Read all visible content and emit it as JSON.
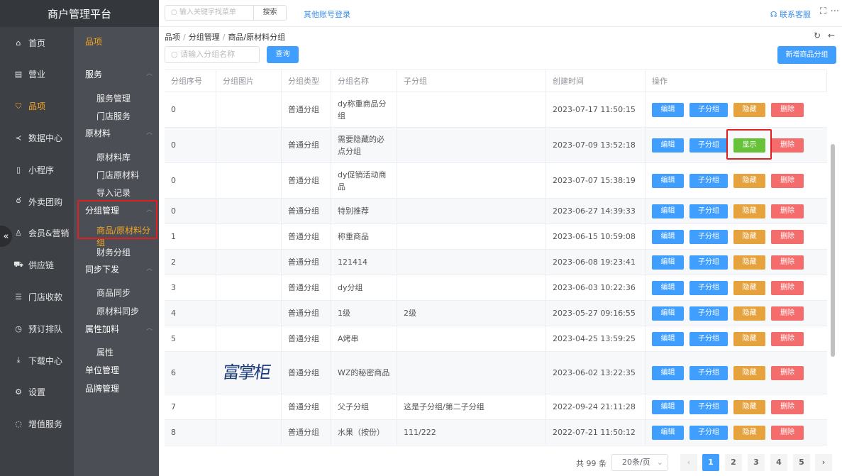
{
  "app": {
    "title": "商户管理平台"
  },
  "topbar": {
    "search_placeholder": "输入关键字找菜单",
    "search_button": "搜索",
    "other_login": "其他账号登录",
    "service": "联系客服"
  },
  "nav_primary": [
    {
      "label": "首页",
      "icon": "home-icon"
    },
    {
      "label": "营业",
      "icon": "calendar-icon"
    },
    {
      "label": "品项",
      "icon": "bag-icon",
      "active": true
    },
    {
      "label": "数据中心",
      "icon": "share-icon"
    },
    {
      "label": "小程序",
      "icon": "phone-icon"
    },
    {
      "label": "外卖团购",
      "icon": "bike-icon"
    },
    {
      "label": "会员&营销",
      "icon": "user-icon"
    },
    {
      "label": "供应链",
      "icon": "truck-icon"
    },
    {
      "label": "门店收款",
      "icon": "wallet-icon"
    },
    {
      "label": "预订排队",
      "icon": "clock-icon"
    },
    {
      "label": "下载中心",
      "icon": "download-icon"
    },
    {
      "label": "设置",
      "icon": "gear-icon"
    },
    {
      "label": "增值服务",
      "icon": "gift-icon"
    }
  ],
  "nav_secondary": {
    "header": "品项",
    "groups": [
      {
        "label": "服务",
        "items": [
          "服务管理",
          "门店服务"
        ]
      },
      {
        "label": "原材料",
        "items": [
          "原材料库",
          "门店原材料",
          "导入记录"
        ]
      },
      {
        "label": "分组管理",
        "items": [
          "商品/原材料分组",
          "财务分组"
        ]
      },
      {
        "label": "同步下发",
        "items": [
          "商品同步",
          "原材料同步"
        ]
      },
      {
        "label": "属性加料",
        "items": [
          "属性"
        ]
      }
    ],
    "singles": [
      "单位管理",
      "品牌管理"
    ],
    "active_item": "商品/原材料分组"
  },
  "breadcrumb": [
    "品项",
    "分组管理",
    "商品/原材料分组"
  ],
  "filter": {
    "placeholder": "请输入分组名称",
    "query_button": "查询",
    "add_button": "新增商品分组"
  },
  "table": {
    "columns": [
      "分组序号",
      "分组图片",
      "分组类型",
      "分组名称",
      "子分组",
      "创建时间",
      "操作"
    ],
    "actions": {
      "edit": "编辑",
      "sub": "子分组",
      "hide": "隐藏",
      "show": "显示",
      "delete": "删除"
    },
    "rows": [
      {
        "seq": "0",
        "type": "普通分组",
        "name": "dy称重商品分组",
        "sub": "",
        "time": "2023-07-17 11:50:15",
        "visible": true
      },
      {
        "seq": "0",
        "type": "普通分组",
        "name": "需要隐藏的必点分组",
        "sub": "",
        "time": "2023-07-09 13:52:18",
        "visible": false
      },
      {
        "seq": "0",
        "type": "普通分组",
        "name": "dy促销活动商品",
        "sub": "",
        "time": "2023-07-07 15:38:19",
        "visible": true
      },
      {
        "seq": "0",
        "type": "普通分组",
        "name": "特别推荐",
        "sub": "",
        "time": "2023-06-27 14:39:33",
        "visible": true
      },
      {
        "seq": "1",
        "type": "普通分组",
        "name": "称重商品",
        "sub": "",
        "time": "2023-06-15 10:59:08",
        "visible": true
      },
      {
        "seq": "2",
        "type": "普通分组",
        "name": "121414",
        "sub": "",
        "time": "2023-06-08 19:23:41",
        "visible": true
      },
      {
        "seq": "3",
        "type": "普通分组",
        "name": "dy分组",
        "sub": "",
        "time": "2023-06-03 10:22:36",
        "visible": true
      },
      {
        "seq": "4",
        "type": "普通分组",
        "name": "1级",
        "sub": "2级",
        "time": "2023-05-27 09:16:55",
        "visible": true
      },
      {
        "seq": "5",
        "type": "普通分组",
        "name": "A烤串",
        "sub": "",
        "time": "2023-04-25 13:59:25",
        "visible": true
      },
      {
        "seq": "6",
        "type": "普通分组",
        "name": "WZ的秘密商品",
        "sub": "",
        "time": "2023-06-02 13:22:35",
        "visible": true,
        "image_text": "富掌柜"
      },
      {
        "seq": "7",
        "type": "普通分组",
        "name": "父子分组",
        "sub": "这是子分组/第二子分组",
        "time": "2022-09-24 21:11:28",
        "visible": true
      },
      {
        "seq": "8",
        "type": "普通分组",
        "name": "水果（按份）",
        "sub": "111/222",
        "time": "2022-07-21 11:50:12",
        "visible": true
      }
    ]
  },
  "pagination": {
    "total": "共 99 条",
    "page_size": "20条/页",
    "pages": [
      "1",
      "2",
      "3",
      "4",
      "5"
    ],
    "current": "1"
  },
  "colors": {
    "primary": "#409eff",
    "warning": "#e6a23c",
    "success": "#67c23a",
    "danger": "#f56c6c",
    "accent": "#f5a623",
    "highlight_box": "#e02020"
  }
}
